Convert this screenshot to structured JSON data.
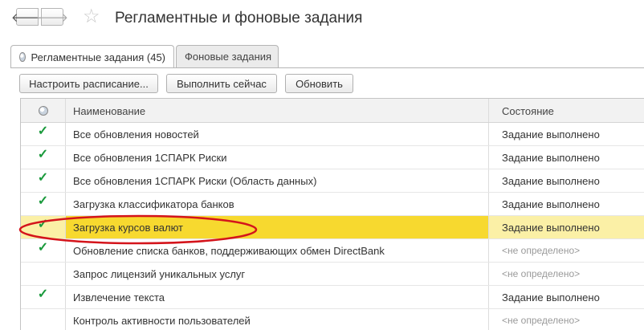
{
  "nav": {
    "back_icon": "arrow-left-icon",
    "forward_icon": "arrow-right-icon",
    "back_glyph": "🡐",
    "forward_glyph": "🡒",
    "favorite_glyph": "☆"
  },
  "window": {
    "title": "Регламентные и фоновые задания"
  },
  "tabs": [
    {
      "label": "Регламентные задания (45)",
      "active": true
    },
    {
      "label": "Фоновые задания",
      "active": false
    }
  ],
  "toolbar": {
    "schedule_label": "Настроить расписание...",
    "run_label": "Выполнить сейчас",
    "refresh_label": "Обновить"
  },
  "table": {
    "columns": {
      "icon": "globe-icon",
      "name": "Наименование",
      "state": "Состояние"
    },
    "check_glyph": "✓",
    "rows": [
      {
        "name": "Все обновления новостей",
        "state": "Задание выполнено",
        "check": true,
        "selected": false
      },
      {
        "name": "Все обновления 1СПАРК Риски",
        "state": "Задание выполнено",
        "check": true,
        "selected": false
      },
      {
        "name": "Все обновления 1СПАРК Риски (Область данных)",
        "state": "Задание выполнено",
        "check": true,
        "selected": false
      },
      {
        "name": "Загрузка классификатора банков",
        "state": "Задание выполнено",
        "check": true,
        "selected": false
      },
      {
        "name": "Загрузка курсов валют",
        "state": "Задание выполнено",
        "check": true,
        "selected": true
      },
      {
        "name": "Обновление списка банков, поддерживающих обмен DirectBank",
        "state": "<не определено>",
        "check": true,
        "selected": false
      },
      {
        "name": "Запрос лицензий уникальных услуг",
        "state": "<не определено>",
        "check": false,
        "selected": false
      },
      {
        "name": "Извлечение текста",
        "state": "Задание выполнено",
        "check": true,
        "selected": false
      },
      {
        "name": "Контроль активности пользователей",
        "state": "<не определено>",
        "check": false,
        "selected": false
      }
    ]
  },
  "colors": {
    "selection": "#f7d92f",
    "check": "#1a9a3c",
    "annotation": "#d4141b"
  }
}
